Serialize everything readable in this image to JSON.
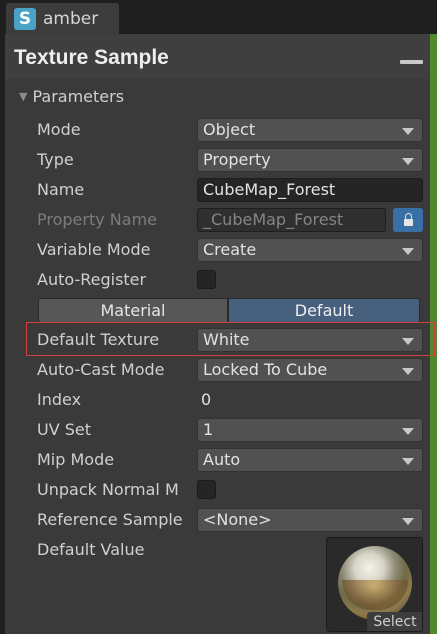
{
  "tab": {
    "icon_letter": "S",
    "label": "amber"
  },
  "node": {
    "title": "Texture Sample"
  },
  "section": {
    "label": "Parameters"
  },
  "rows": {
    "mode": {
      "label": "Mode",
      "value": "Object"
    },
    "type": {
      "label": "Type",
      "value": "Property"
    },
    "name": {
      "label": "Name",
      "value": "CubeMap_Forest"
    },
    "property_name": {
      "label": "Property Name",
      "value": "_CubeMap_Forest"
    },
    "variable_mode": {
      "label": "Variable Mode",
      "value": "Create"
    },
    "auto_register": {
      "label": "Auto-Register",
      "checked": false
    },
    "default_texture": {
      "label": "Default Texture",
      "value": "White"
    },
    "auto_cast_mode": {
      "label": "Auto-Cast Mode",
      "value": "Locked To Cube"
    },
    "index": {
      "label": "Index",
      "value": "0"
    },
    "uv_set": {
      "label": "UV Set",
      "value": "1"
    },
    "mip_mode": {
      "label": "Mip Mode",
      "value": "Auto"
    },
    "unpack_normal_map": {
      "label": "Unpack Normal M",
      "checked": false
    },
    "reference_sampler": {
      "label": "Reference Sample",
      "value": "<None>"
    },
    "default_value": {
      "label": "Default Value"
    }
  },
  "toggle": {
    "left": "Material",
    "right": "Default",
    "selected": "Default"
  },
  "preview": {
    "select_label": "Select"
  },
  "colors": {
    "accent": "#46607e",
    "highlight": "#d04040",
    "lock": "#3a6fa6"
  }
}
